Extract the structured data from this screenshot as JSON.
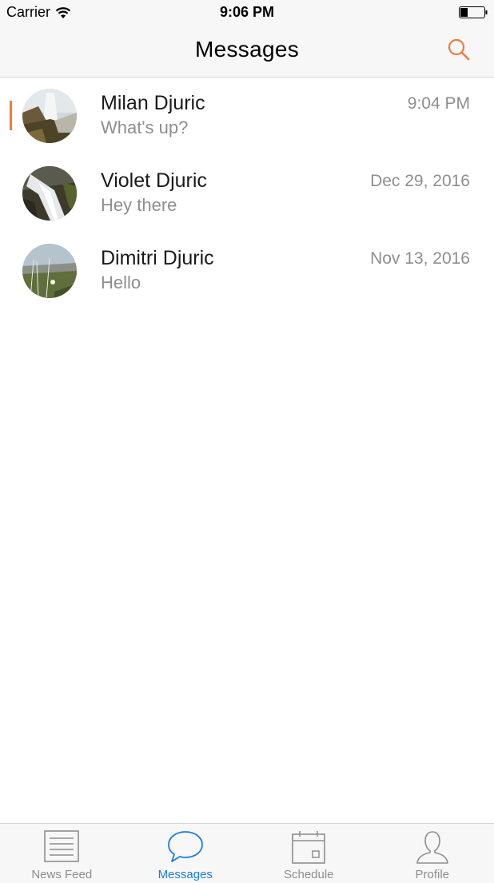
{
  "status_bar": {
    "carrier": "Carrier",
    "time": "9:06 PM"
  },
  "nav": {
    "title": "Messages",
    "search_icon": "search-icon"
  },
  "conversations": [
    {
      "name": "Milan Djuric",
      "preview": "What's up?",
      "date": "9:04 PM",
      "unread": true
    },
    {
      "name": "Violet Djuric",
      "preview": "Hey there",
      "date": "Dec 29, 2016",
      "unread": false
    },
    {
      "name": "Dimitri Djuric",
      "preview": "Hello",
      "date": "Nov 13, 2016",
      "unread": false
    }
  ],
  "tabs": [
    {
      "label": "News Feed",
      "icon": "news-feed-icon",
      "active": false
    },
    {
      "label": "Messages",
      "icon": "chat-bubble-icon",
      "active": true
    },
    {
      "label": "Schedule",
      "icon": "calendar-icon",
      "active": false
    },
    {
      "label": "Profile",
      "icon": "profile-icon",
      "active": false
    }
  ],
  "colors": {
    "accent": "#f07b3f",
    "active_tab": "#1a7ee0",
    "muted": "#8e8e8e"
  }
}
